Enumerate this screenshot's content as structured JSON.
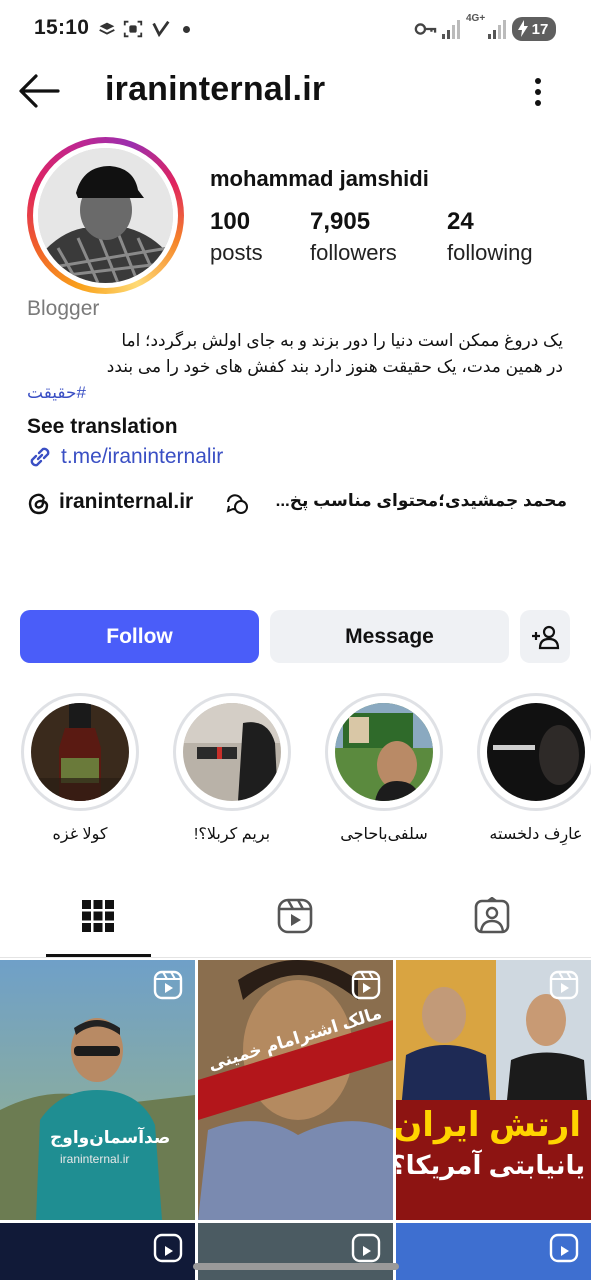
{
  "status_bar": {
    "time": "15:10",
    "network": "4G+",
    "battery": "17"
  },
  "header": {
    "title": "iraninternal.ir"
  },
  "profile": {
    "name": "mohammad jamshidi",
    "stats": [
      {
        "value": "100",
        "label": "posts"
      },
      {
        "value": "7,905",
        "label": "followers"
      },
      {
        "value": "24",
        "label": "following"
      }
    ],
    "category": "Blogger",
    "bio_lines": [
      "یک دروغ ممکن است دنیا را دور بزند و به جای اولش برگردد؛ اما",
      "در همین مدت، یک حقیقت هنوز دارد بند کفش های خود را می بندد"
    ],
    "hashtag": "#حقیقت",
    "see_translation": "See translation",
    "link": "t.me/iraninternalir",
    "threads_name": "iraninternal.ir",
    "threads_text": "محمد جمشیدی؛محتوای مناسب پخ..."
  },
  "actions": {
    "follow": "Follow",
    "message": "Message"
  },
  "highlights": [
    {
      "label": "کولا غزه"
    },
    {
      "label": "بریم کربلا؟!"
    },
    {
      "label": "سلفی‌باحاجی"
    },
    {
      "label": "عارِف دلخسته"
    }
  ],
  "tabs": [
    {
      "icon": "grid-icon",
      "active": true
    },
    {
      "icon": "reels-icon",
      "active": false
    },
    {
      "icon": "tagged-icon",
      "active": false
    }
  ],
  "posts": [
    {
      "caption": "صدآسمان‌واوج",
      "sub": "iraninternal.ir"
    },
    {
      "caption": "مالک اشترامام خمینی"
    },
    {
      "caption_top": "ارتش ایران",
      "caption_bottom": "یانیابتی آمریکا؟"
    }
  ],
  "colors": {
    "follow_button": "#4a5df9",
    "link": "#3a4fc4",
    "secondary_button": "#eff1f4"
  }
}
